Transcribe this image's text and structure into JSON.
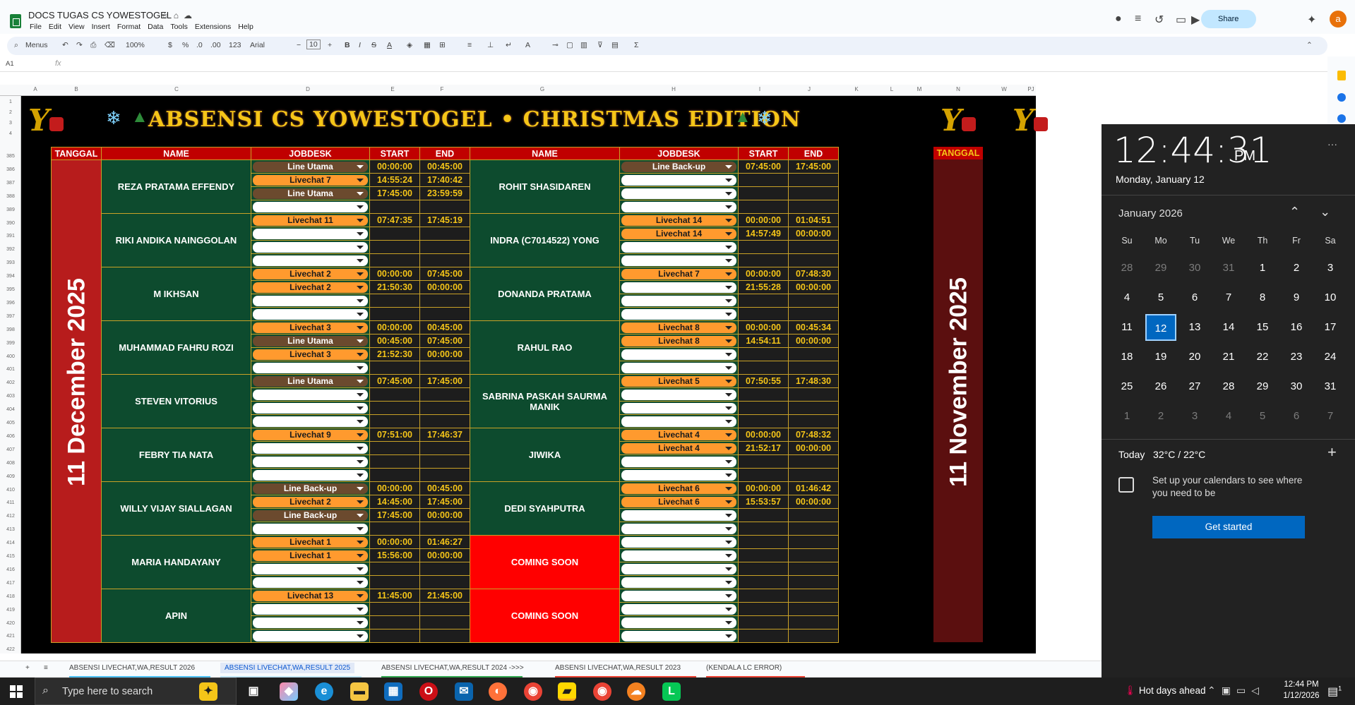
{
  "header": {
    "doc_title": "DOCS TUGAS CS YOWESTOGEL",
    "menu": [
      "File",
      "Edit",
      "View",
      "Insert",
      "Format",
      "Data",
      "Tools",
      "Extensions",
      "Help"
    ],
    "share_label": "Share",
    "avatar_letter": "a"
  },
  "toolbar": {
    "menus_label": "Menus",
    "zoom": "100%",
    "currency": "$",
    "percent": "%",
    "dec_minus": ".0",
    "dec_plus": ".00",
    "number_fmt": "123",
    "font": "Arial",
    "font_size": "10"
  },
  "formula": {
    "cell_ref": "A1",
    "fx": "fx"
  },
  "columns": [
    "A",
    "B",
    "C",
    "D",
    "E",
    "F",
    "G",
    "H",
    "I",
    "J",
    "K",
    "L",
    "M",
    "N",
    "W",
    "PJ"
  ],
  "rows": [
    "1",
    "2",
    "3",
    "4",
    "385",
    "386",
    "387",
    "388",
    "389",
    "390",
    "391",
    "392",
    "393",
    "394",
    "395",
    "396",
    "397",
    "398",
    "399",
    "400",
    "401",
    "402",
    "403",
    "404",
    "405",
    "406",
    "407",
    "408",
    "409",
    "410",
    "411",
    "412",
    "413",
    "414",
    "415",
    "416",
    "417",
    "418",
    "419",
    "420",
    "421",
    "422"
  ],
  "banner": {
    "title": "ABSENSI CS YOWESTOGEL • CHRISTMAS EDITION",
    "logo_text": "Y"
  },
  "table": {
    "headers": {
      "date": "TANGGAL",
      "name": "NAME",
      "job": "JOBDESK",
      "start": "START",
      "end": "END"
    },
    "left_date": "11 December 2025",
    "right_date": "11 November 2025",
    "right_header": "TANGGAL",
    "left_names": [
      "REZA PRATAMA EFFENDY",
      "RIKI ANDIKA NAINGGOLAN",
      "M IKHSAN",
      "MUHAMMAD FAHRU ROZI",
      "STEVEN VITORIUS",
      "FEBRY TIA NATA",
      "WILLY VIJAY SIALLAGAN",
      "MARIA HANDAYANY",
      "APIN"
    ],
    "right_names": [
      "ROHIT SHASIDAREN",
      "INDRA (C7014522) YONG",
      "DONANDA PRATAMA",
      "RAHUL RAO",
      "SABRINA PASKAH SAURMA MANIK",
      "JIWIKA",
      "DEDI SYAHPUTRA",
      "COMING SOON",
      "COMING SOON"
    ],
    "left_rows": [
      [
        [
          "Line Utama",
          "00:00:00",
          "00:45:00"
        ],
        [
          "Livechat 7",
          "14:55:24",
          "17:40:42"
        ],
        [
          "Line Utama",
          "17:45:00",
          "23:59:59"
        ],
        [
          "",
          "",
          ""
        ]
      ],
      [
        [
          "Livechat 11",
          "07:47:35",
          "17:45:19"
        ],
        [
          "",
          "",
          ""
        ],
        [
          "",
          "",
          ""
        ],
        [
          "",
          "",
          ""
        ]
      ],
      [
        [
          "Livechat 2",
          "00:00:00",
          "07:45:00"
        ],
        [
          "Livechat 2",
          "21:50:30",
          "00:00:00"
        ],
        [
          "",
          "",
          ""
        ],
        [
          "",
          "",
          ""
        ]
      ],
      [
        [
          "Livechat 3",
          "00:00:00",
          "00:45:00"
        ],
        [
          "Line Utama",
          "00:45:00",
          "07:45:00"
        ],
        [
          "Livechat 3",
          "21:52:30",
          "00:00:00"
        ],
        [
          "",
          "",
          ""
        ]
      ],
      [
        [
          "Line Utama",
          "07:45:00",
          "17:45:00"
        ],
        [
          "",
          "",
          ""
        ],
        [
          "",
          "",
          ""
        ],
        [
          "",
          "",
          ""
        ]
      ],
      [
        [
          "Livechat 9",
          "07:51:00",
          "17:46:37"
        ],
        [
          "",
          "",
          ""
        ],
        [
          "",
          "",
          ""
        ],
        [
          "",
          "",
          ""
        ]
      ],
      [
        [
          "Line Back-up",
          "00:00:00",
          "00:45:00"
        ],
        [
          "Livechat 2",
          "14:45:00",
          "17:45:00"
        ],
        [
          "Line Back-up",
          "17:45:00",
          "00:00:00"
        ],
        [
          "",
          "",
          ""
        ]
      ],
      [
        [
          "Livechat 1",
          "00:00:00",
          "01:46:27"
        ],
        [
          "Livechat 1",
          "15:56:00",
          "00:00:00"
        ],
        [
          "",
          "",
          ""
        ],
        [
          "",
          "",
          ""
        ]
      ],
      [
        [
          "Livechat 13",
          "11:45:00",
          "21:45:00"
        ],
        [
          "",
          "",
          ""
        ],
        [
          "",
          "",
          ""
        ],
        [
          "",
          "",
          ""
        ]
      ]
    ],
    "right_rows": [
      [
        [
          "Line Back-up",
          "07:45:00",
          "17:45:00"
        ],
        [
          "",
          "",
          ""
        ],
        [
          "",
          "",
          ""
        ],
        [
          "",
          "",
          ""
        ]
      ],
      [
        [
          "Livechat 14",
          "00:00:00",
          "01:04:51"
        ],
        [
          "Livechat 14",
          "14:57:49",
          "00:00:00"
        ],
        [
          "",
          "",
          ""
        ],
        [
          "",
          "",
          ""
        ]
      ],
      [
        [
          "Livechat 7",
          "00:00:00",
          "07:48:30"
        ],
        [
          "",
          "21:55:28",
          "00:00:00"
        ],
        [
          "",
          "",
          ""
        ],
        [
          "",
          "",
          ""
        ]
      ],
      [
        [
          "Livechat 8",
          "00:00:00",
          "00:45:34"
        ],
        [
          "Livechat 8",
          "14:54:11",
          "00:00:00"
        ],
        [
          "",
          "",
          ""
        ],
        [
          "",
          "",
          ""
        ]
      ],
      [
        [
          "Livechat 5",
          "07:50:55",
          "17:48:30"
        ],
        [
          "",
          "",
          ""
        ],
        [
          "",
          "",
          ""
        ],
        [
          "",
          "",
          ""
        ]
      ],
      [
        [
          "Livechat 4",
          "00:00:00",
          "07:48:32"
        ],
        [
          "Livechat 4",
          "21:52:17",
          "00:00:00"
        ],
        [
          "",
          "",
          ""
        ],
        [
          "",
          "",
          ""
        ]
      ],
      [
        [
          "Livechat 6",
          "00:00:00",
          "01:46:42"
        ],
        [
          "Livechat 6",
          "15:53:57",
          "00:00:00"
        ],
        [
          "",
          "",
          ""
        ],
        [
          "",
          "",
          ""
        ]
      ],
      [
        [
          "",
          "",
          ""
        ],
        [
          "",
          "",
          ""
        ],
        [
          "",
          "",
          ""
        ],
        [
          "",
          "",
          ""
        ]
      ],
      [
        [
          "",
          "",
          ""
        ],
        [
          "",
          "",
          ""
        ],
        [
          "",
          "",
          ""
        ],
        [
          "",
          "",
          ""
        ]
      ]
    ]
  },
  "sheet_tabs": [
    {
      "label": "ABSENSI LIVECHAT,WA,RESULT 2026",
      "color": "#4fc3f7"
    },
    {
      "label": "ABSENSI LIVECHAT,WA,RESULT 2025",
      "color": "#c2e7ff",
      "active": true
    },
    {
      "label": "ABSENSI LIVECHAT,WA,RESULT 2024 ->>>",
      "color": "#34a853"
    },
    {
      "label": "ABSENSI LIVECHAT,WA,RESULT 2023",
      "color": "#ea4335"
    },
    {
      "label": "(KENDALA LC ERROR)",
      "color": "#ea4335"
    }
  ],
  "calendar": {
    "time": "12:44:31",
    "ampm": "PM",
    "full_date": "Monday, January 12",
    "month": "January 2026",
    "dow": [
      "Su",
      "Mo",
      "Tu",
      "We",
      "Th",
      "Fr",
      "Sa"
    ],
    "weeks": [
      [
        "28",
        "29",
        "30",
        "31",
        "1",
        "2",
        "3"
      ],
      [
        "4",
        "5",
        "6",
        "7",
        "8",
        "9",
        "10"
      ],
      [
        "11",
        "12",
        "13",
        "14",
        "15",
        "16",
        "17"
      ],
      [
        "18",
        "19",
        "20",
        "21",
        "22",
        "23",
        "24"
      ],
      [
        "25",
        "26",
        "27",
        "28",
        "29",
        "30",
        "31"
      ],
      [
        "1",
        "2",
        "3",
        "4",
        "5",
        "6",
        "7"
      ]
    ],
    "today_label": "Today",
    "weather": "32°C / 22°C",
    "setup_msg": "Set up your calendars to see where you need to be",
    "get_started": "Get started"
  },
  "taskbar": {
    "search_placeholder": "Type here to search",
    "weather_text": "Hot days ahead",
    "time": "12:44 PM",
    "date": "1/12/2026",
    "notif_count": "1"
  }
}
